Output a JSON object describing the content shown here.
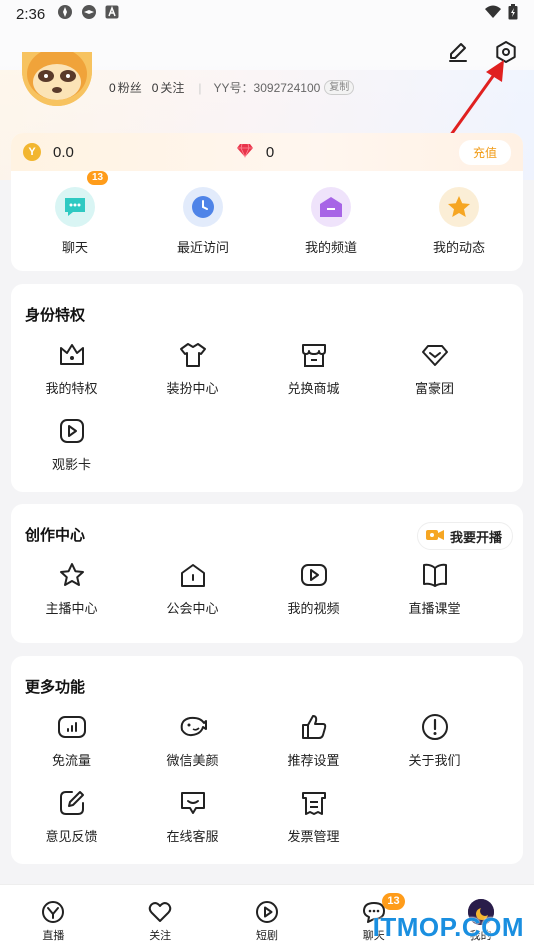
{
  "status": {
    "time": "2:36"
  },
  "profile": {
    "fans_count": "0",
    "fans_label": "粉丝",
    "follow_count": "0",
    "follow_label": "关注",
    "yy_label": "YY号：",
    "yy_number": "3092724100",
    "copy_label": "复制"
  },
  "wallet": {
    "coin_value": "0.0",
    "gem_value": "0",
    "recharge_label": "充值"
  },
  "quick": [
    {
      "label": "聊天",
      "badge": "13"
    },
    {
      "label": "最近访问"
    },
    {
      "label": "我的频道"
    },
    {
      "label": "我的动态"
    }
  ],
  "identity": {
    "title": "身份特权",
    "items": [
      "我的特权",
      "装扮中心",
      "兑换商城",
      "富豪团",
      "观影卡"
    ]
  },
  "creation": {
    "title": "创作中心",
    "live_label": "我要开播",
    "items": [
      "主播中心",
      "公会中心",
      "我的视频",
      "直播课堂"
    ]
  },
  "more": {
    "title": "更多功能",
    "items": [
      "免流量",
      "微信美颜",
      "推荐设置",
      "关于我们",
      "意见反馈",
      "在线客服",
      "发票管理"
    ]
  },
  "nav": {
    "items": [
      {
        "label": "直播"
      },
      {
        "label": "关注"
      },
      {
        "label": "短剧"
      },
      {
        "label": "聊天",
        "badge": "13"
      },
      {
        "label": "我的"
      }
    ]
  },
  "watermark": "ITMOP.COM",
  "colors": {
    "accent": "#f19a14",
    "badge": "#ff9c1a",
    "arrow": "#e02020"
  }
}
